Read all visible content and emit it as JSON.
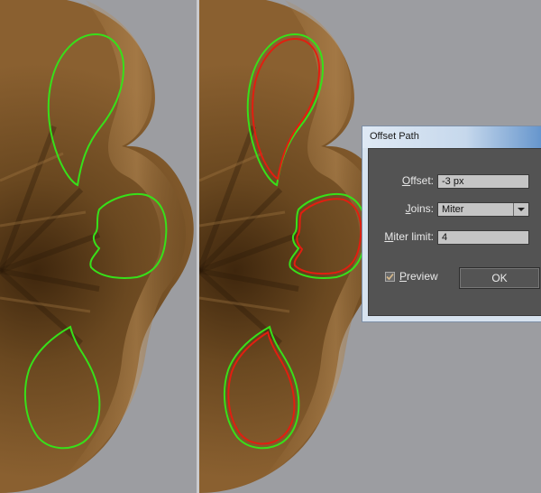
{
  "canvas": {
    "background": "#9c9da1",
    "artwork_colors": {
      "shell_dark": "#4a2f12",
      "shell_mid": "#7a5424",
      "shell_light": "#a97f4b"
    },
    "path_colors": {
      "original_path": "#37e01a",
      "offset_path": "#e21e10"
    }
  },
  "dialog": {
    "title": "Offset Path",
    "offset": {
      "label_access": "O",
      "label_rest": "ffset:",
      "value": "-3 px"
    },
    "joins": {
      "label_access": "J",
      "label_rest": "oins:",
      "value": "Miter"
    },
    "miter_limit": {
      "label_access": "M",
      "label_rest": "iter limit:",
      "value": "4"
    },
    "preview": {
      "label_access": "P",
      "label_rest": "review",
      "checked": true
    },
    "ok_label": "OK"
  }
}
